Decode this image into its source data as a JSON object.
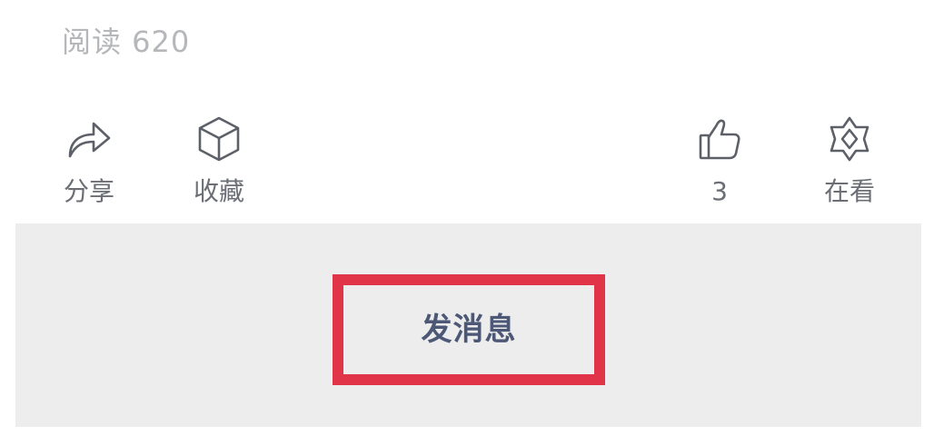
{
  "article": {
    "read_count": "阅读 620"
  },
  "actions": {
    "share": {
      "label": "分享",
      "icon": "share-arrow-icon"
    },
    "collect": {
      "label": "收藏",
      "icon": "cube-icon"
    },
    "like": {
      "label": "3",
      "icon": "thumbs-up-icon"
    },
    "looking": {
      "label": "在看",
      "icon": "sparkle-star-icon"
    }
  },
  "bottom_bar": {
    "send_message_label": "发消息",
    "highlight_color": "#e23448",
    "background": "#ededed"
  }
}
